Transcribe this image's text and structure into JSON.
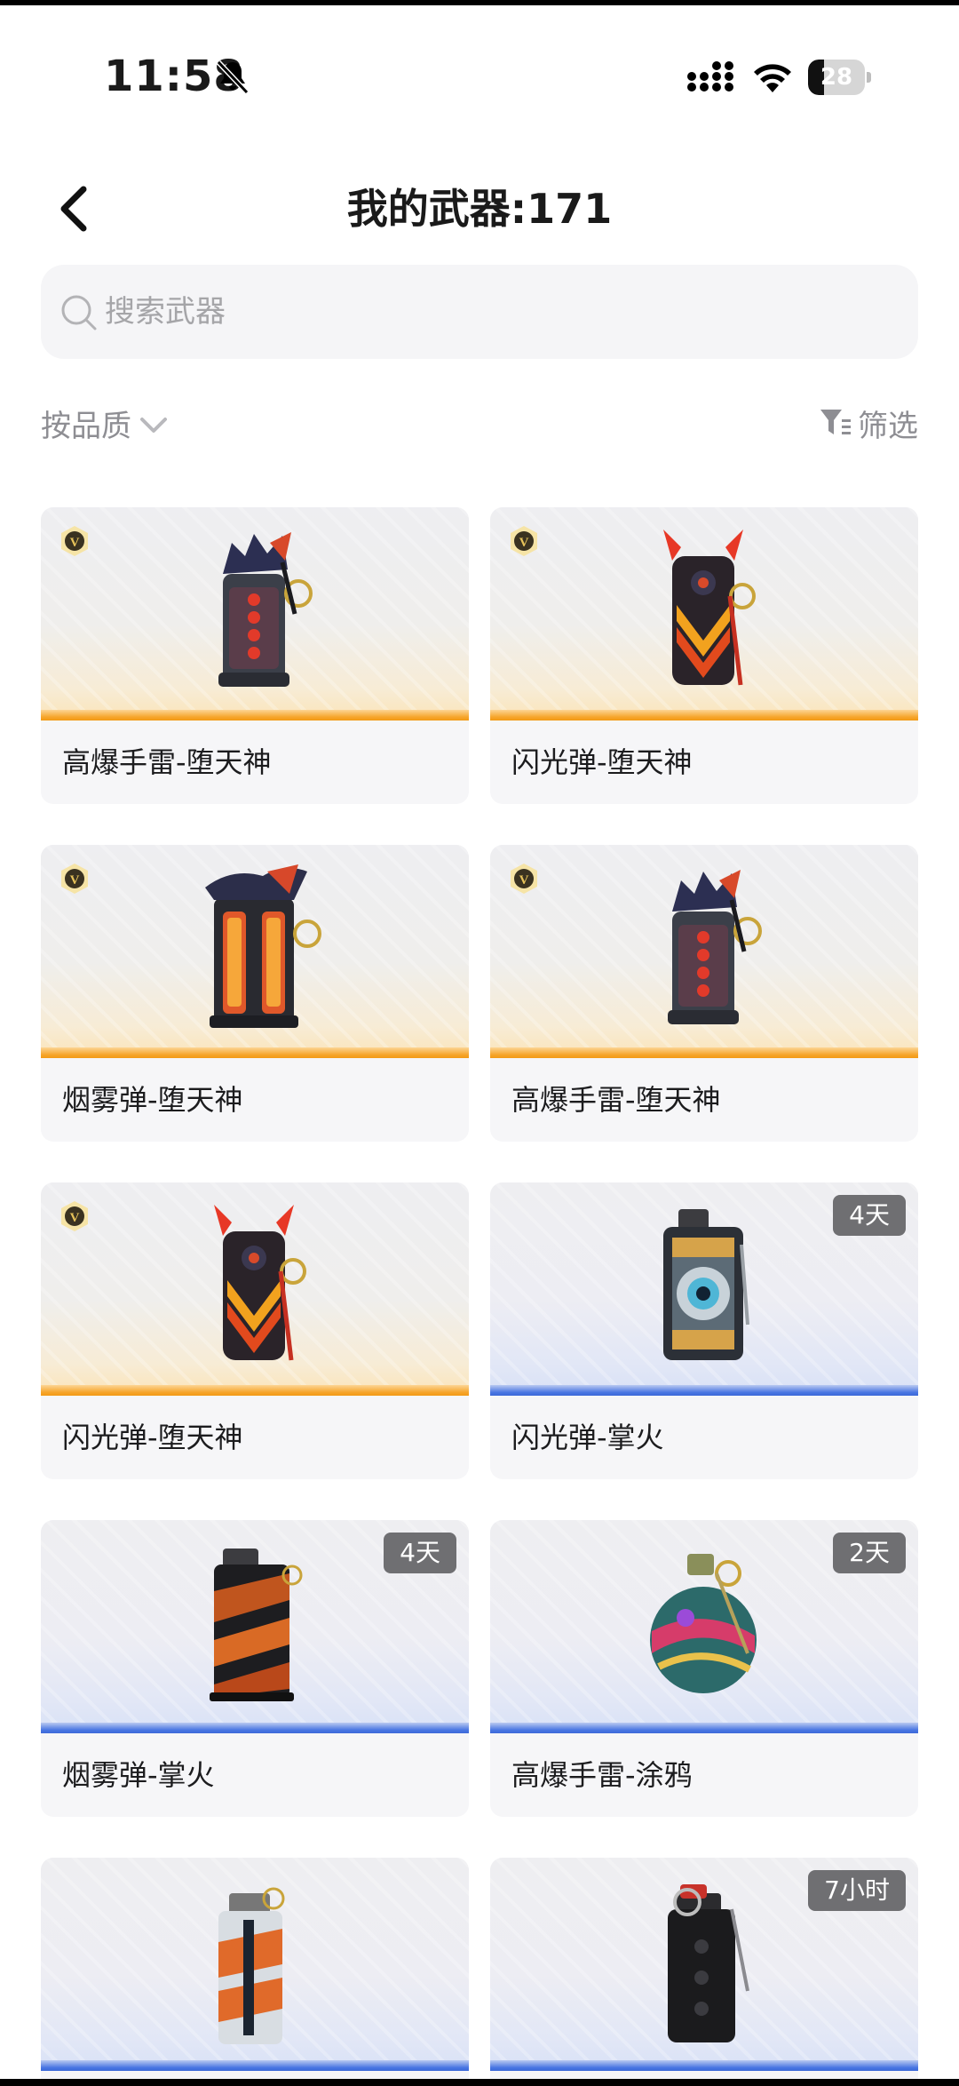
{
  "status": {
    "time": "11:58",
    "battery": "28",
    "battery_level": 0.28
  },
  "header": {
    "title": "我的武器:171"
  },
  "search": {
    "placeholder": "搜索武器"
  },
  "toolbar": {
    "sort_label": "按品质",
    "filter_label": "筛选"
  },
  "colors": {
    "legend_bar": "#f39a15",
    "rare_bar": "#3c69d8",
    "badge_bg": "#6f6f72"
  },
  "cards": [
    {
      "name": "高爆手雷-堕天神",
      "tier": "legend",
      "badge": "",
      "vip": true,
      "icon": "frag-grenade-fallen-god-icon"
    },
    {
      "name": "闪光弹-堕天神",
      "tier": "legend",
      "badge": "",
      "vip": true,
      "icon": "flashbang-fallen-god-icon"
    },
    {
      "name": "烟雾弹-堕天神",
      "tier": "legend",
      "badge": "",
      "vip": true,
      "icon": "smoke-grenade-fallen-god-icon"
    },
    {
      "name": "高爆手雷-堕天神",
      "tier": "legend",
      "badge": "",
      "vip": true,
      "icon": "frag-grenade-fallen-god-icon"
    },
    {
      "name": "闪光弹-堕天神",
      "tier": "legend",
      "badge": "",
      "vip": true,
      "icon": "flashbang-fallen-god-icon"
    },
    {
      "name": "闪光弹-掌火",
      "tier": "rare",
      "badge": "4天",
      "vip": false,
      "icon": "flashbang-fire-palm-icon"
    },
    {
      "name": "烟雾弹-掌火",
      "tier": "rare",
      "badge": "4天",
      "vip": false,
      "icon": "smoke-grenade-fire-palm-icon"
    },
    {
      "name": "高爆手雷-涂鸦",
      "tier": "rare",
      "badge": "2天",
      "vip": false,
      "icon": "frag-grenade-graffiti-icon"
    },
    {
      "name": "",
      "tier": "rare",
      "badge": "",
      "vip": false,
      "icon": "flash-bang-canister-icon"
    },
    {
      "name": "",
      "tier": "rare",
      "badge": "7小时",
      "vip": false,
      "icon": "black-grenade-icon"
    }
  ]
}
